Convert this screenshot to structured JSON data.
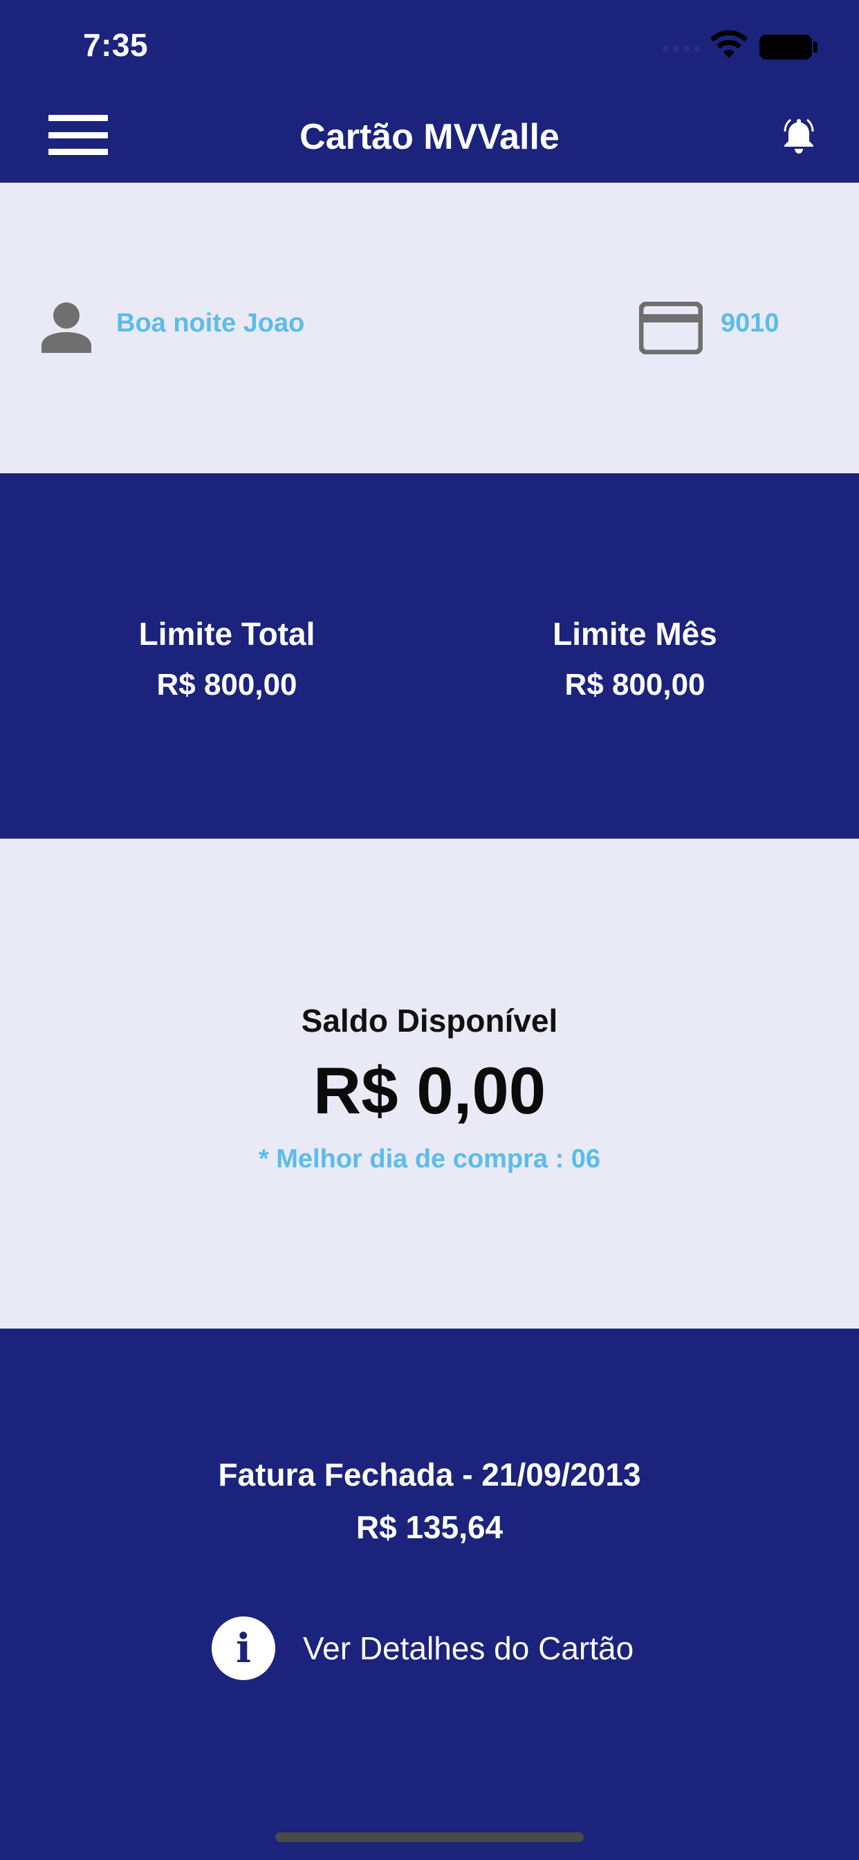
{
  "status_bar": {
    "time": "7:35"
  },
  "header": {
    "title": "Cartão MVValle",
    "menu_icon": "hamburger-menu-icon",
    "bell_icon": "bell-icon"
  },
  "greeting": {
    "text": "Boa noite Joao",
    "card_number": "9010",
    "user_icon": "person-icon",
    "card_icon": "credit-card-icon"
  },
  "limits": {
    "total_label": "Limite Total",
    "total_value": "R$ 800,00",
    "month_label": "Limite Mês",
    "month_value": "R$ 800,00"
  },
  "balance": {
    "label": "Saldo Disponível",
    "value": "R$ 0,00",
    "best_day": "* Melhor dia de compra : 06"
  },
  "invoice": {
    "title": "Fatura Fechada - 21/09/2013",
    "value": "R$ 135,64",
    "details_label": "Ver Detalhes do Cartão",
    "details_icon": "info-icon"
  },
  "colors": {
    "navy": "#1b237c",
    "light": "#e9eaf5",
    "accent": "#5bbcea",
    "icon_gray": "#6f6f6f"
  }
}
